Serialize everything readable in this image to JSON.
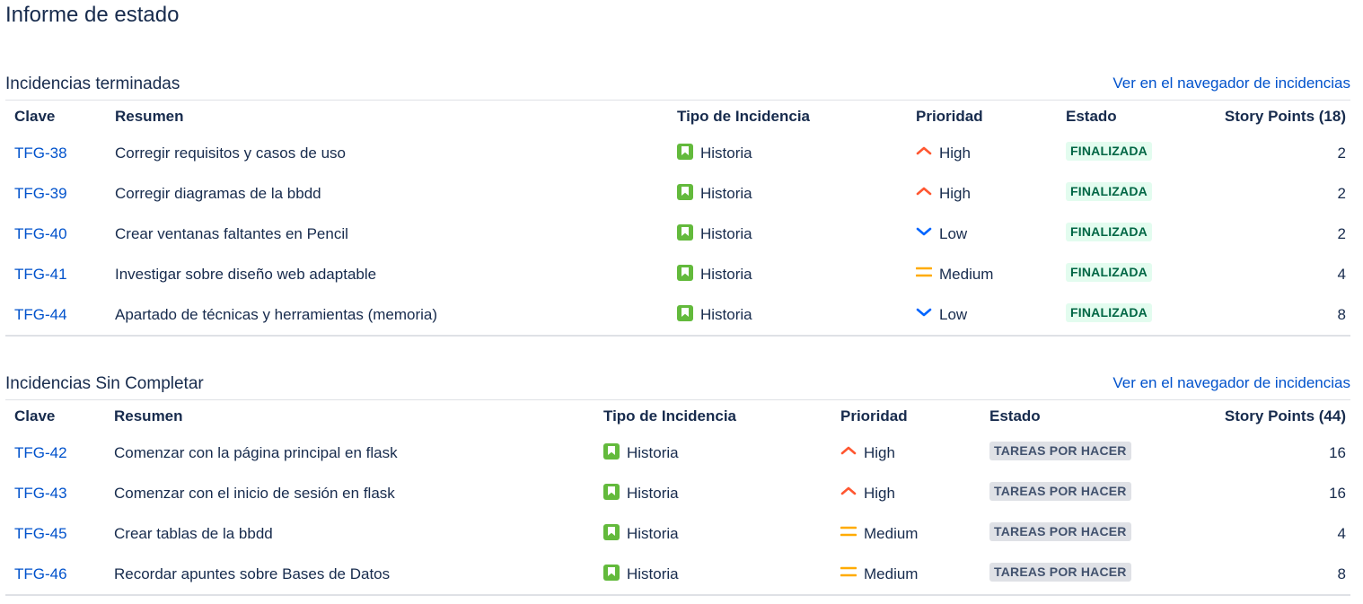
{
  "page": {
    "title": "Informe de estado"
  },
  "colors": {
    "link": "#0052cc",
    "story_icon": "#63ba3c",
    "high": "#ff5630",
    "low": "#0065ff",
    "medium": "#ffab00",
    "done_bg": "#e3fcef",
    "done_text": "#006644",
    "todo_bg": "#dfe1e6",
    "todo_text": "#42526e"
  },
  "completed": {
    "title": "Incidencias terminadas",
    "link": "Ver en el navegador de incidencias",
    "headers": {
      "key": "Clave",
      "summary": "Resumen",
      "type": "Tipo de Incidencia",
      "priority": "Prioridad",
      "status": "Estado",
      "points": "Story Points (18)"
    },
    "rows": [
      {
        "key": "TFG-38",
        "summary": "Corregir requisitos y casos de uso",
        "type": "Historia",
        "type_icon": "story-icon",
        "priority": "High",
        "priority_icon": "priority-high-icon",
        "status": "FINALIZADA",
        "points": "2"
      },
      {
        "key": "TFG-39",
        "summary": "Corregir diagramas de la bbdd",
        "type": "Historia",
        "type_icon": "story-icon",
        "priority": "High",
        "priority_icon": "priority-high-icon",
        "status": "FINALIZADA",
        "points": "2"
      },
      {
        "key": "TFG-40",
        "summary": "Crear ventanas faltantes en Pencil",
        "type": "Historia",
        "type_icon": "story-icon",
        "priority": "Low",
        "priority_icon": "priority-low-icon",
        "status": "FINALIZADA",
        "points": "2"
      },
      {
        "key": "TFG-41",
        "summary": "Investigar sobre diseño web adaptable",
        "type": "Historia",
        "type_icon": "story-icon",
        "priority": "Medium",
        "priority_icon": "priority-medium-icon",
        "status": "FINALIZADA",
        "points": "4"
      },
      {
        "key": "TFG-44",
        "summary": "Apartado de técnicas y herramientas (memoria)",
        "type": "Historia",
        "type_icon": "story-icon",
        "priority": "Low",
        "priority_icon": "priority-low-icon",
        "status": "FINALIZADA",
        "points": "8"
      }
    ]
  },
  "incomplete": {
    "title": "Incidencias Sin Completar",
    "link": "Ver en el navegador de incidencias",
    "headers": {
      "key": "Clave",
      "summary": "Resumen",
      "type": "Tipo de Incidencia",
      "priority": "Prioridad",
      "status": "Estado",
      "points": "Story Points (44)"
    },
    "rows": [
      {
        "key": "TFG-42",
        "summary": "Comenzar con la página principal en flask",
        "type": "Historia",
        "type_icon": "story-icon",
        "priority": "High",
        "priority_icon": "priority-high-icon",
        "status": "TAREAS POR HACER",
        "points": "16"
      },
      {
        "key": "TFG-43",
        "summary": "Comenzar con el inicio de sesión en flask",
        "type": "Historia",
        "type_icon": "story-icon",
        "priority": "High",
        "priority_icon": "priority-high-icon",
        "status": "TAREAS POR HACER",
        "points": "16"
      },
      {
        "key": "TFG-45",
        "summary": "Crear tablas de la bbdd",
        "type": "Historia",
        "type_icon": "story-icon",
        "priority": "Medium",
        "priority_icon": "priority-medium-icon",
        "status": "TAREAS POR HACER",
        "points": "4"
      },
      {
        "key": "TFG-46",
        "summary": "Recordar apuntes sobre Bases de Datos",
        "type": "Historia",
        "type_icon": "story-icon",
        "priority": "Medium",
        "priority_icon": "priority-medium-icon",
        "status": "TAREAS POR HACER",
        "points": "8"
      }
    ]
  }
}
